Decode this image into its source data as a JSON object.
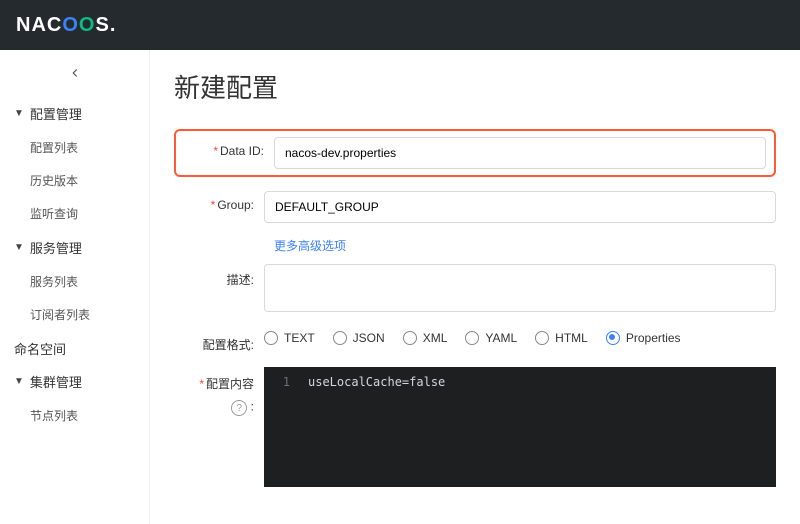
{
  "brand": {
    "n": "N",
    "a": "A",
    "c": "C",
    "o1": "O",
    "o2": "O",
    "s": "S",
    "dot": "."
  },
  "sidebar": {
    "groups": [
      {
        "label": "配置管理",
        "items": [
          "配置列表",
          "历史版本",
          "监听查询"
        ]
      },
      {
        "label": "服务管理",
        "items": [
          "服务列表",
          "订阅者列表"
        ]
      },
      {
        "label": "命名空间",
        "items": []
      },
      {
        "label": "集群管理",
        "items": [
          "节点列表"
        ]
      }
    ]
  },
  "page": {
    "title": "新建配置",
    "form": {
      "dataId": {
        "label": "Data ID:",
        "value": "nacos-dev.properties"
      },
      "group": {
        "label": "Group:",
        "value": "DEFAULT_GROUP"
      },
      "advanced": "更多高级选项",
      "desc": {
        "label": "描述:",
        "value": ""
      },
      "format": {
        "label": "配置格式:",
        "options": [
          "TEXT",
          "JSON",
          "XML",
          "YAML",
          "HTML",
          "Properties"
        ],
        "selected": "Properties"
      },
      "content": {
        "label": "配置内容",
        "hint": "?",
        "lineno": "1",
        "code": "useLocalCache=false"
      }
    }
  }
}
